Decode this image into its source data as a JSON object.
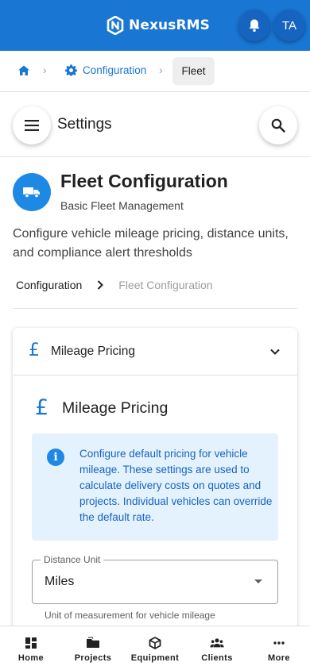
{
  "app": {
    "brand_name": "NexusRMS",
    "avatar_initials": "TA",
    "accent_color": "#1976d2"
  },
  "breadcrumb": {
    "items": [
      {
        "label": "Configuration",
        "icon": "gear-icon"
      },
      {
        "label": "Fleet"
      }
    ]
  },
  "settings_bar": {
    "title": "Settings"
  },
  "page": {
    "title": "Fleet Configuration",
    "subtitle": "Basic Fleet Management",
    "description": "Configure vehicle mileage pricing, distance units, and compliance alert thresholds",
    "trail": {
      "parent": "Configuration",
      "current": "Fleet Configuration"
    }
  },
  "accordion": {
    "header_title": "Mileage Pricing",
    "section_title": "Mileage Pricing",
    "currency_symbol": "£",
    "info_text": "Configure default pricing for vehicle mileage. These settings are used to calculate delivery costs on quotes and projects. Individual vehicles can override the default rate.",
    "distance_unit": {
      "label": "Distance Unit",
      "value": "Miles",
      "helper": "Unit of measurement for vehicle mileage"
    }
  },
  "bottom_nav": {
    "items": [
      {
        "label": "Home",
        "icon": "home-grid-icon"
      },
      {
        "label": "Projects",
        "icon": "folder-icon"
      },
      {
        "label": "Equipment",
        "icon": "box-icon"
      },
      {
        "label": "Clients",
        "icon": "people-icon"
      },
      {
        "label": "More",
        "icon": "more-dots-icon"
      }
    ]
  }
}
